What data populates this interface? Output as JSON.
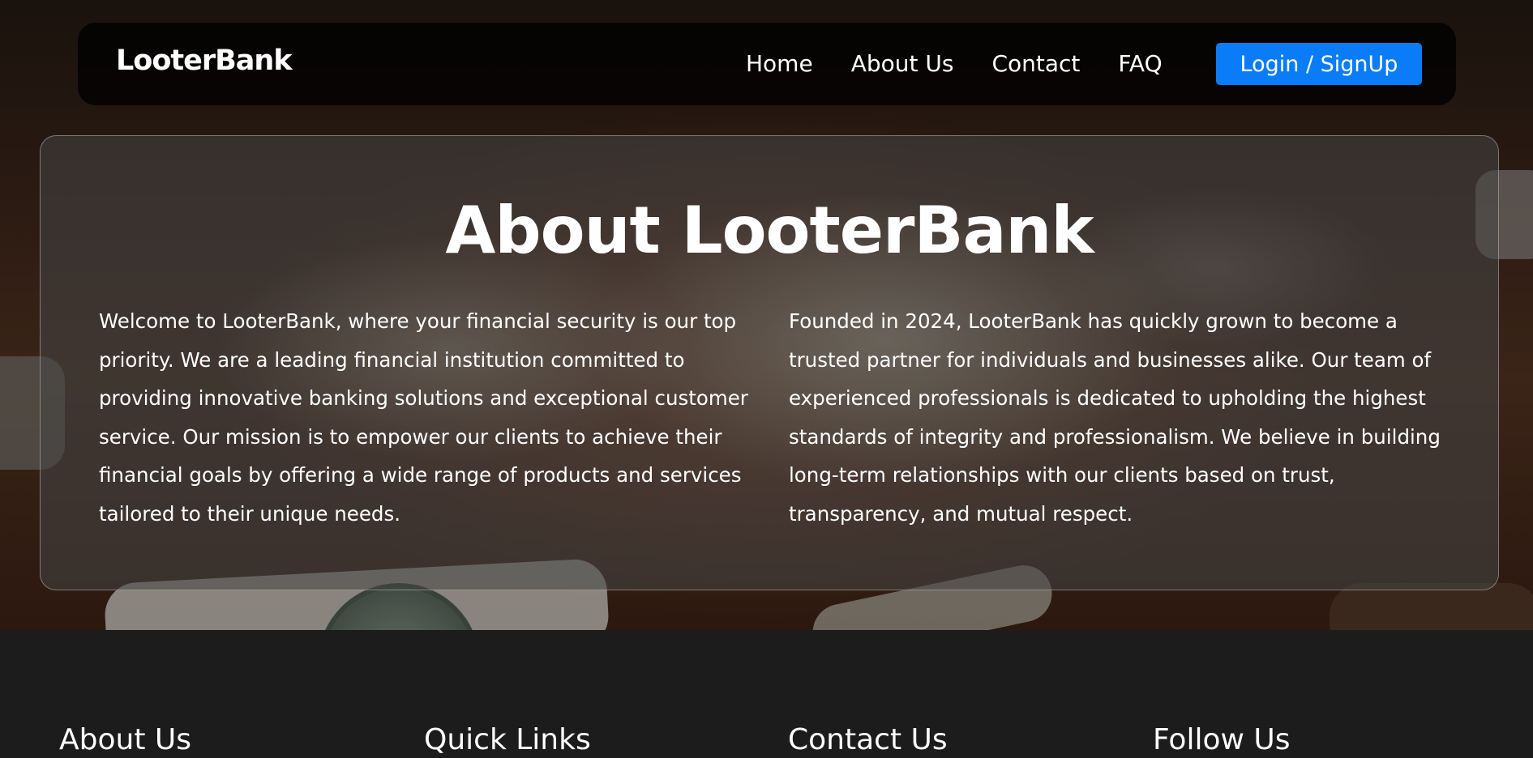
{
  "navbar": {
    "brand": "LooterBank",
    "links": [
      "Home",
      "About Us",
      "Contact",
      "FAQ"
    ],
    "login_label": "Login / SignUp"
  },
  "about": {
    "title": "About LooterBank",
    "paragraphs": [
      "Welcome to LooterBank, where your financial security is our top priority. We are a leading financial institution committed to providing innovative banking solutions and exceptional customer service. Our mission is to empower our clients to achieve their financial goals by offering a wide range of products and services tailored to their unique needs.",
      "Founded in 2024, LooterBank has quickly grown to become a trusted partner for individuals and businesses alike. Our team of experienced professionals is dedicated to upholding the highest standards of integrity and professionalism. We believe in building long-term relationships with our clients based on trust, transparency, and mutual respect."
    ]
  },
  "footer": {
    "headings": [
      "About Us",
      "Quick Links",
      "Contact Us",
      "Follow Us"
    ]
  },
  "colors": {
    "accent": "#0a7cf8",
    "footer_bg": "#1c1c1c"
  }
}
